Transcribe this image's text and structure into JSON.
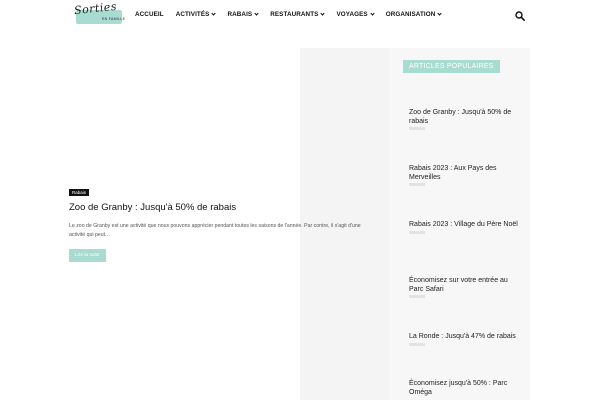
{
  "header": {
    "logo": {
      "script": "Sorties",
      "subtitle": "EN FAMILLE"
    },
    "nav": [
      {
        "label": "ACCUEIL",
        "has_dropdown": false
      },
      {
        "label": "ACTIVITÉS",
        "has_dropdown": true
      },
      {
        "label": "RABAIS",
        "has_dropdown": true
      },
      {
        "label": "RESTAURANTS",
        "has_dropdown": true
      },
      {
        "label": "VOYAGES",
        "has_dropdown": true
      },
      {
        "label": "ORGANISATION",
        "has_dropdown": true
      }
    ],
    "search_icon": "search-icon"
  },
  "main": {
    "post": {
      "category": "Rabais",
      "title": "Zoo de Granby : Jusqu'à 50% de rabais",
      "excerpt": "Le zoo de Granby est une activité que nous pouvons apprécier pendant toutes les saisons de l'année. Par contre, il s'agit d'une activité qui peut…",
      "read_more": "Lire la suite"
    }
  },
  "sidebar": {
    "title": "ARTICLES POPULAIRES",
    "posts": [
      {
        "title": "Zoo de Granby : Jusqu'à 50% de rabais"
      },
      {
        "title": "Rabais 2023 : Aux Pays des Merveilles"
      },
      {
        "title": "Rabais 2023 : Village du Père Noël"
      },
      {
        "title": "Économisez sur votre entrée au Parc Safari"
      },
      {
        "title": "La Ronde : Jusqu'à 47% de rabais"
      },
      {
        "title": "Économisez jusqu'à 50% : Parc Oméga"
      }
    ]
  },
  "colors": {
    "accent": "#a8dcd1",
    "text": "#111111",
    "muted": "#555555"
  }
}
